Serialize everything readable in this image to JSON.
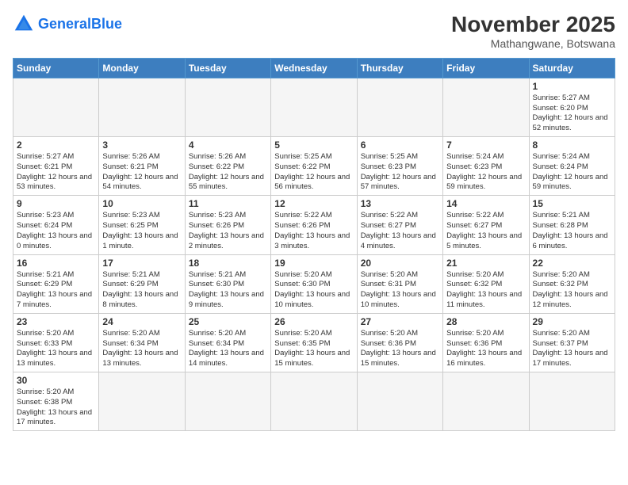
{
  "header": {
    "logo_general": "General",
    "logo_blue": "Blue",
    "month_year": "November 2025",
    "location": "Mathangwane, Botswana"
  },
  "days_of_week": [
    "Sunday",
    "Monday",
    "Tuesday",
    "Wednesday",
    "Thursday",
    "Friday",
    "Saturday"
  ],
  "weeks": [
    {
      "cells": [
        {
          "day": null,
          "info": null
        },
        {
          "day": null,
          "info": null
        },
        {
          "day": null,
          "info": null
        },
        {
          "day": null,
          "info": null
        },
        {
          "day": null,
          "info": null
        },
        {
          "day": null,
          "info": null
        },
        {
          "day": "1",
          "info": "Sunrise: 5:27 AM\nSunset: 6:20 PM\nDaylight: 12 hours\nand 52 minutes."
        }
      ]
    },
    {
      "cells": [
        {
          "day": "2",
          "info": "Sunrise: 5:27 AM\nSunset: 6:21 PM\nDaylight: 12 hours\nand 53 minutes."
        },
        {
          "day": "3",
          "info": "Sunrise: 5:26 AM\nSunset: 6:21 PM\nDaylight: 12 hours\nand 54 minutes."
        },
        {
          "day": "4",
          "info": "Sunrise: 5:26 AM\nSunset: 6:22 PM\nDaylight: 12 hours\nand 55 minutes."
        },
        {
          "day": "5",
          "info": "Sunrise: 5:25 AM\nSunset: 6:22 PM\nDaylight: 12 hours\nand 56 minutes."
        },
        {
          "day": "6",
          "info": "Sunrise: 5:25 AM\nSunset: 6:23 PM\nDaylight: 12 hours\nand 57 minutes."
        },
        {
          "day": "7",
          "info": "Sunrise: 5:24 AM\nSunset: 6:23 PM\nDaylight: 12 hours\nand 59 minutes."
        },
        {
          "day": "8",
          "info": "Sunrise: 5:24 AM\nSunset: 6:24 PM\nDaylight: 12 hours\nand 59 minutes."
        }
      ]
    },
    {
      "cells": [
        {
          "day": "9",
          "info": "Sunrise: 5:23 AM\nSunset: 6:24 PM\nDaylight: 13 hours\nand 0 minutes."
        },
        {
          "day": "10",
          "info": "Sunrise: 5:23 AM\nSunset: 6:25 PM\nDaylight: 13 hours\nand 1 minute."
        },
        {
          "day": "11",
          "info": "Sunrise: 5:23 AM\nSunset: 6:26 PM\nDaylight: 13 hours\nand 2 minutes."
        },
        {
          "day": "12",
          "info": "Sunrise: 5:22 AM\nSunset: 6:26 PM\nDaylight: 13 hours\nand 3 minutes."
        },
        {
          "day": "13",
          "info": "Sunrise: 5:22 AM\nSunset: 6:27 PM\nDaylight: 13 hours\nand 4 minutes."
        },
        {
          "day": "14",
          "info": "Sunrise: 5:22 AM\nSunset: 6:27 PM\nDaylight: 13 hours\nand 5 minutes."
        },
        {
          "day": "15",
          "info": "Sunrise: 5:21 AM\nSunset: 6:28 PM\nDaylight: 13 hours\nand 6 minutes."
        }
      ]
    },
    {
      "cells": [
        {
          "day": "16",
          "info": "Sunrise: 5:21 AM\nSunset: 6:29 PM\nDaylight: 13 hours\nand 7 minutes."
        },
        {
          "day": "17",
          "info": "Sunrise: 5:21 AM\nSunset: 6:29 PM\nDaylight: 13 hours\nand 8 minutes."
        },
        {
          "day": "18",
          "info": "Sunrise: 5:21 AM\nSunset: 6:30 PM\nDaylight: 13 hours\nand 9 minutes."
        },
        {
          "day": "19",
          "info": "Sunrise: 5:20 AM\nSunset: 6:30 PM\nDaylight: 13 hours\nand 10 minutes."
        },
        {
          "day": "20",
          "info": "Sunrise: 5:20 AM\nSunset: 6:31 PM\nDaylight: 13 hours\nand 10 minutes."
        },
        {
          "day": "21",
          "info": "Sunrise: 5:20 AM\nSunset: 6:32 PM\nDaylight: 13 hours\nand 11 minutes."
        },
        {
          "day": "22",
          "info": "Sunrise: 5:20 AM\nSunset: 6:32 PM\nDaylight: 13 hours\nand 12 minutes."
        }
      ]
    },
    {
      "cells": [
        {
          "day": "23",
          "info": "Sunrise: 5:20 AM\nSunset: 6:33 PM\nDaylight: 13 hours\nand 13 minutes."
        },
        {
          "day": "24",
          "info": "Sunrise: 5:20 AM\nSunset: 6:34 PM\nDaylight: 13 hours\nand 13 minutes."
        },
        {
          "day": "25",
          "info": "Sunrise: 5:20 AM\nSunset: 6:34 PM\nDaylight: 13 hours\nand 14 minutes."
        },
        {
          "day": "26",
          "info": "Sunrise: 5:20 AM\nSunset: 6:35 PM\nDaylight: 13 hours\nand 15 minutes."
        },
        {
          "day": "27",
          "info": "Sunrise: 5:20 AM\nSunset: 6:36 PM\nDaylight: 13 hours\nand 15 minutes."
        },
        {
          "day": "28",
          "info": "Sunrise: 5:20 AM\nSunset: 6:36 PM\nDaylight: 13 hours\nand 16 minutes."
        },
        {
          "day": "29",
          "info": "Sunrise: 5:20 AM\nSunset: 6:37 PM\nDaylight: 13 hours\nand 17 minutes."
        }
      ]
    },
    {
      "cells": [
        {
          "day": "30",
          "info": "Sunrise: 5:20 AM\nSunset: 6:38 PM\nDaylight: 13 hours\nand 17 minutes."
        },
        {
          "day": null,
          "info": null
        },
        {
          "day": null,
          "info": null
        },
        {
          "day": null,
          "info": null
        },
        {
          "day": null,
          "info": null
        },
        {
          "day": null,
          "info": null
        },
        {
          "day": null,
          "info": null
        }
      ]
    }
  ]
}
